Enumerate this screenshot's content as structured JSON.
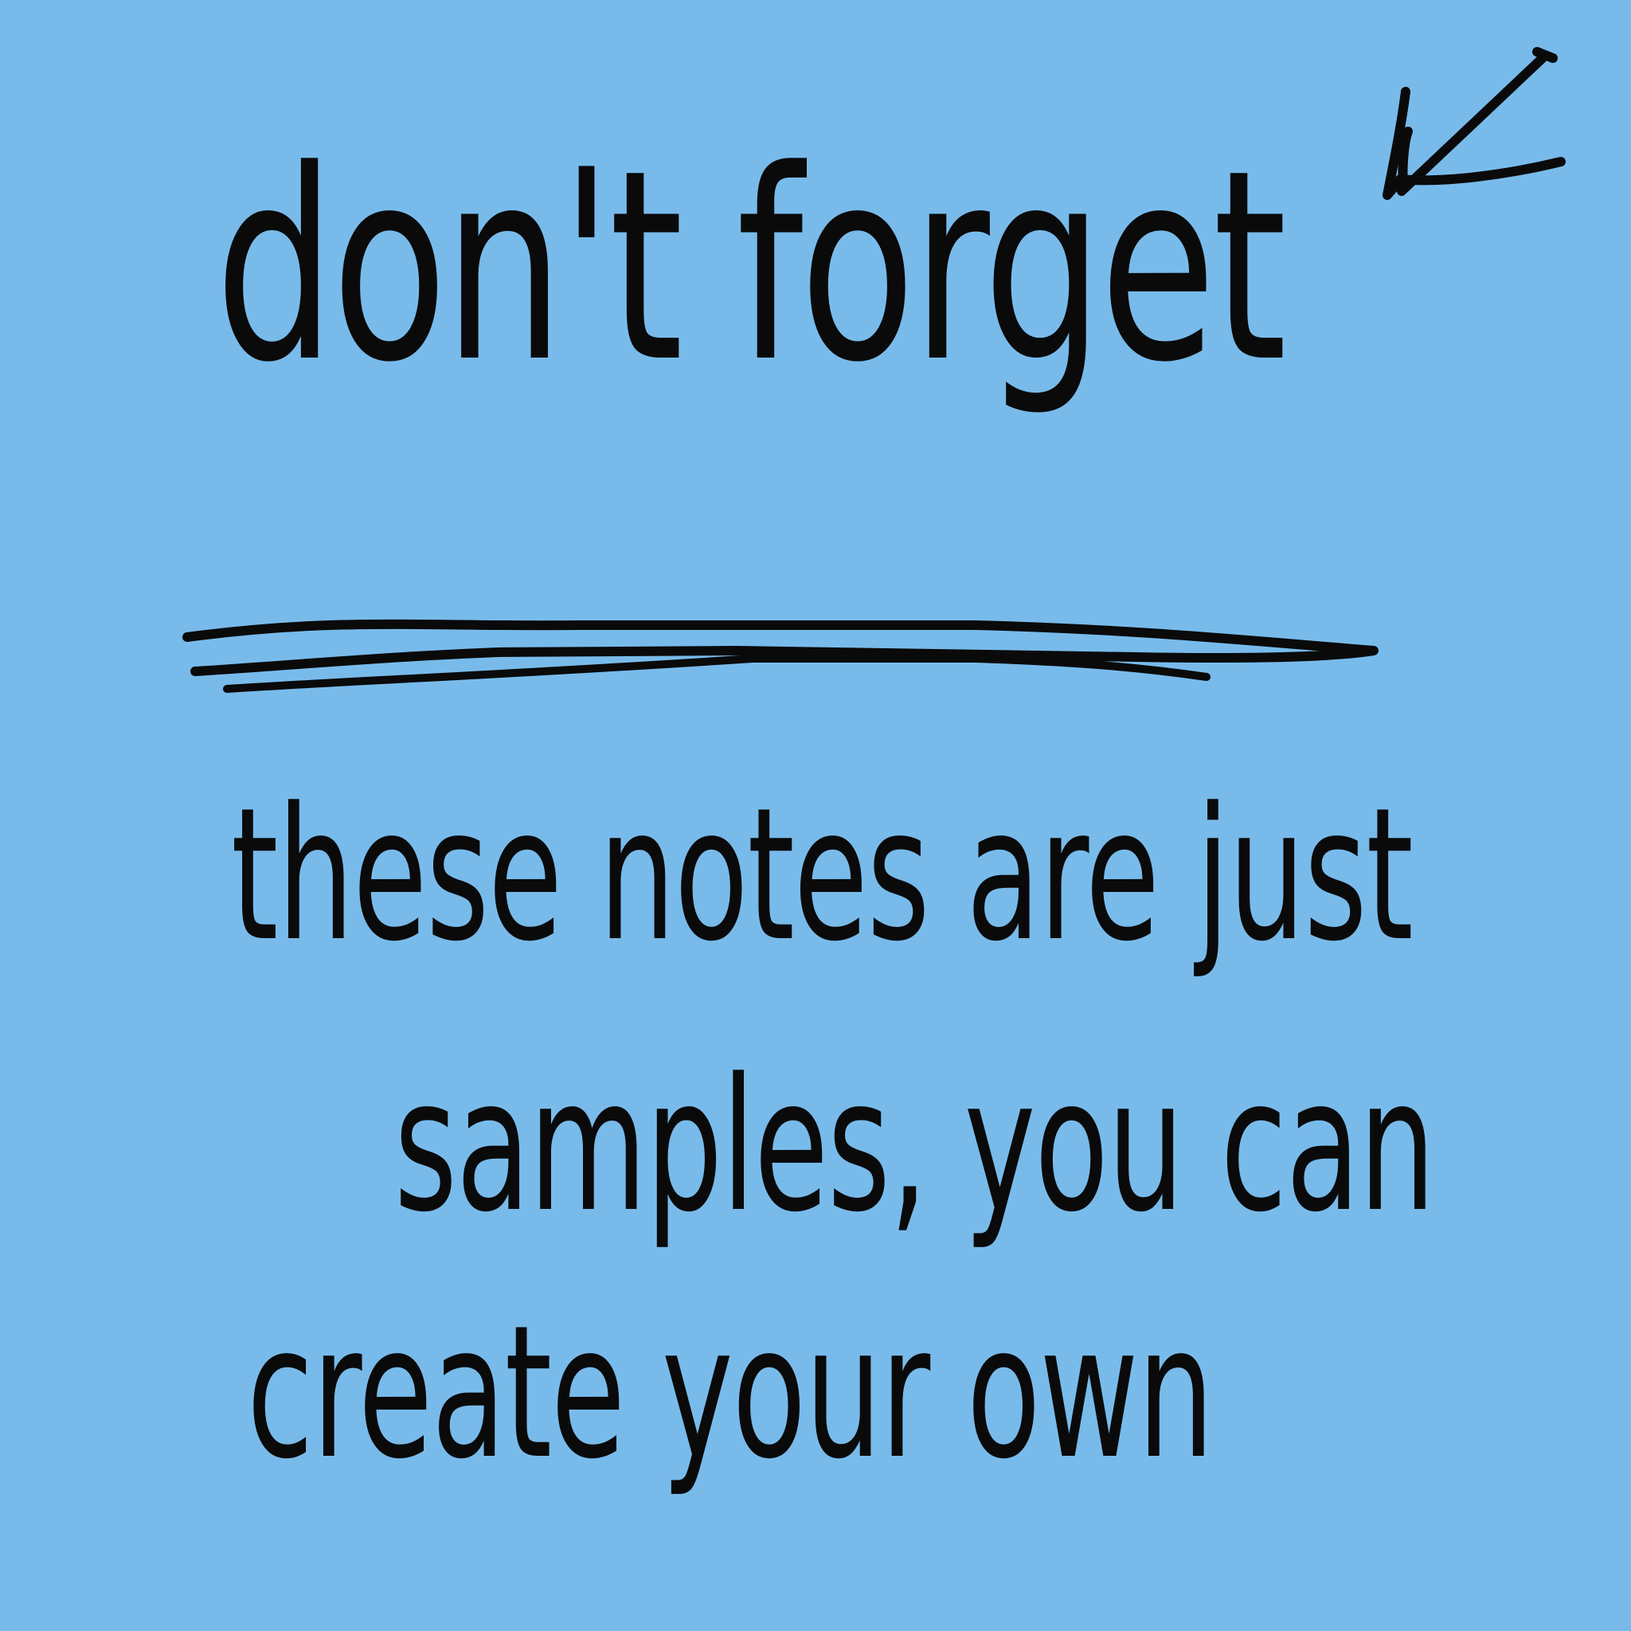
{
  "note": {
    "title": "don't forget",
    "message_lines": [
      "these notes are just",
      "samples, you can",
      "create your own"
    ],
    "icons": {
      "arrow": "arrow-down-left-icon",
      "underline": "double-underline-scribble"
    },
    "colors": {
      "background": "#78bbeb",
      "ink": "#0a0a0a"
    }
  }
}
